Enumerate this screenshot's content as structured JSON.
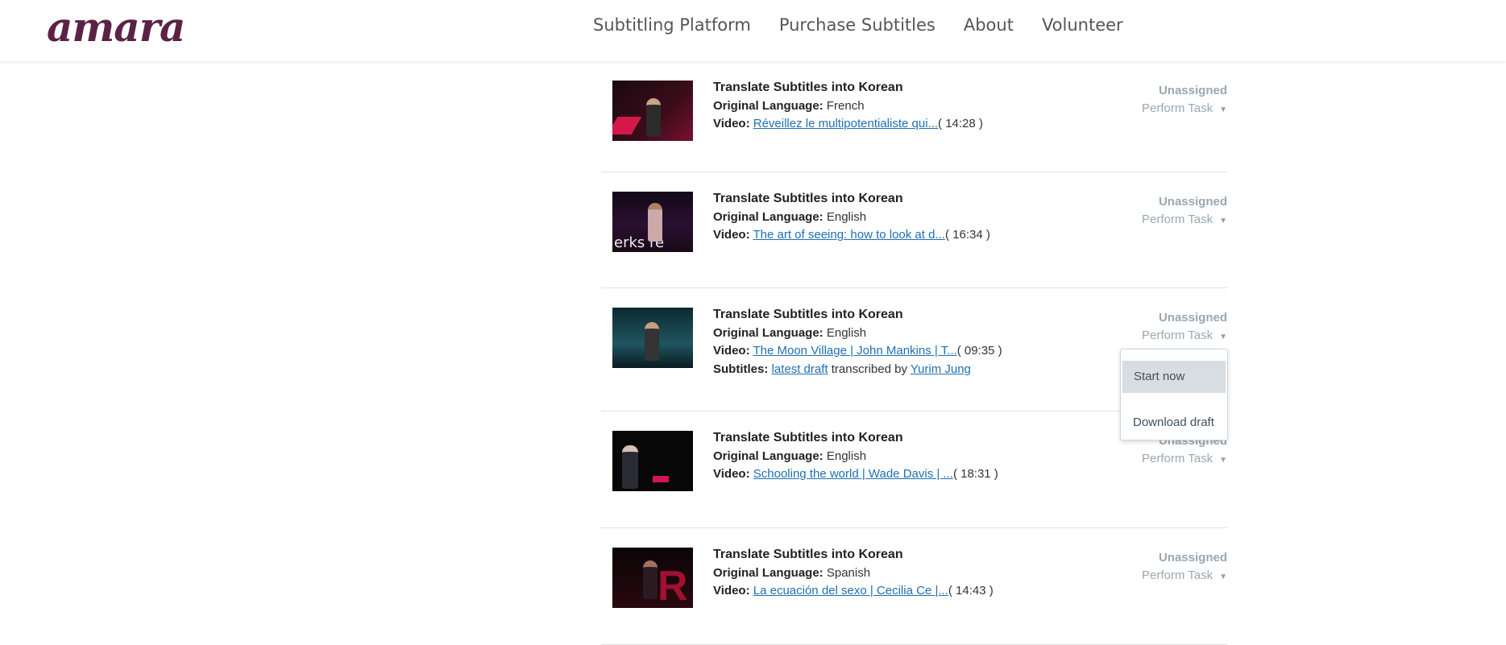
{
  "header": {
    "logo": "amara",
    "nav": [
      "Subtitling Platform",
      "Purchase Subtitles",
      "About",
      "Volunteer"
    ]
  },
  "tasks": [
    {
      "title": "Translate Subtitles into Korean",
      "lang_label": "Original Language:",
      "language": "French",
      "video_label": "Video:",
      "video_title": "Réveillez le multipotentialiste qui...",
      "duration": "( 14:28 )",
      "status": "Unassigned",
      "action": "Perform Task"
    },
    {
      "title": "Translate Subtitles into Korean",
      "lang_label": "Original Language:",
      "language": "English",
      "video_label": "Video:",
      "video_title": "The art of seeing: how to look at d...",
      "duration": "( 16:34 )",
      "status": "Unassigned",
      "action": "Perform Task"
    },
    {
      "title": "Translate Subtitles into Korean",
      "lang_label": "Original Language:",
      "language": "English",
      "video_label": "Video:",
      "video_title": "The Moon Village | John Mankins | T...",
      "duration": "( 09:35 )",
      "subtitles_label": "Subtitles:",
      "subtitles_link": "latest draft",
      "transcribed_by": "transcribed by",
      "transcriber": "Yurim Jung",
      "status": "Unassigned",
      "action": "Perform Task"
    },
    {
      "title": "Translate Subtitles into Korean",
      "lang_label": "Original Language:",
      "language": "English",
      "video_label": "Video:",
      "video_title": "Schooling the world | Wade Davis | ...",
      "duration": "( 18:31 )",
      "status": "Unassigned",
      "action": "Perform Task"
    },
    {
      "title": "Translate Subtitles into Korean",
      "lang_label": "Original Language:",
      "language": "Spanish",
      "video_label": "Video:",
      "video_title": "La ecuación del sexo | Cecilia Ce |...",
      "duration": "( 14:43 )",
      "status": "Unassigned",
      "action": "Perform Task"
    }
  ],
  "dropdown": {
    "items": [
      "Start now",
      "Download draft"
    ]
  },
  "icons": {
    "caret": "caret-down-icon"
  },
  "colors": {
    "brand": "#5b2246",
    "link": "#1f6fb2",
    "muted": "#9aa7b3"
  }
}
